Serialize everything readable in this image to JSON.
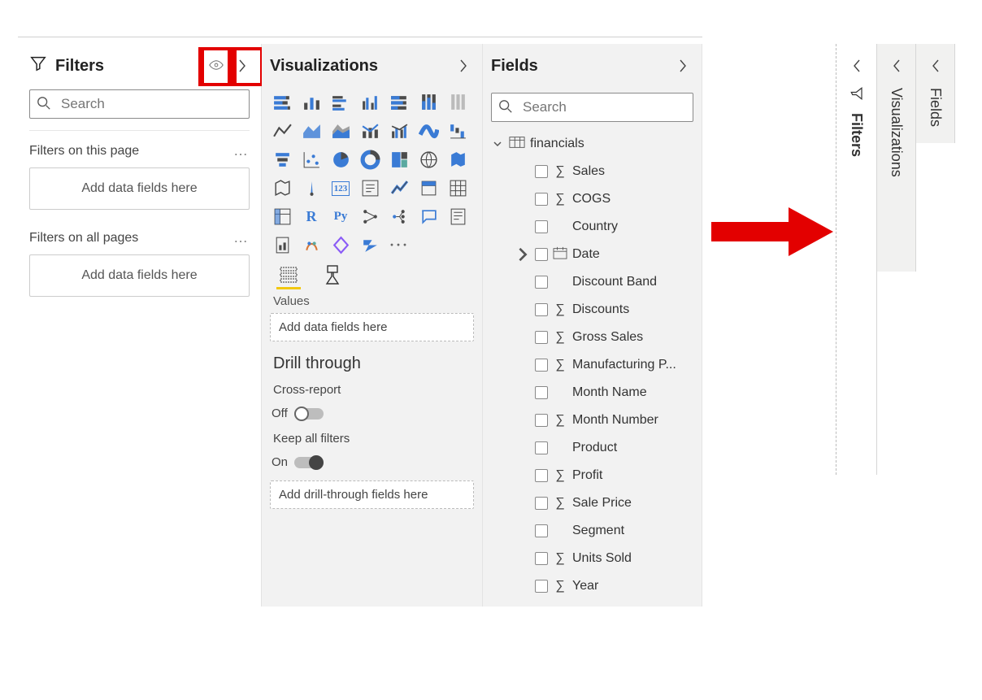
{
  "filters": {
    "title": "Filters",
    "search_placeholder": "Search",
    "section_this_page": "Filters on this page",
    "section_all_pages": "Filters on all pages",
    "drop_label": "Add data fields here"
  },
  "viz": {
    "title": "Visualizations",
    "values_label": "Values",
    "values_drop": "Add data fields here",
    "drill": {
      "title": "Drill through",
      "cross_report_label": "Cross-report",
      "cross_report_value": "Off",
      "keep_filters_label": "Keep all filters",
      "keep_filters_value": "On",
      "drop_label": "Add drill-through fields here"
    },
    "icons": [
      "stacked-bar",
      "stacked-column",
      "clustered-bar",
      "clustered-column",
      "hundred-bar",
      "hundred-column",
      "eraser",
      "line",
      "area",
      "stacked-area",
      "line-stacked",
      "line-clustered",
      "ribbon",
      "waterfall",
      "funnel-sm",
      "scatter",
      "pie",
      "donut",
      "treemap",
      "map",
      "filled-map",
      "azure-map",
      "gauge",
      "card",
      "multi-card",
      "kpi",
      "slicer",
      "table",
      "matrix",
      "r-visual",
      "python",
      "key-influencers",
      "decomp",
      "qna",
      "narrative",
      "paginated",
      "arcgis",
      "powerapps",
      "powerautomate",
      "more",
      "",
      ""
    ]
  },
  "fields": {
    "title": "Fields",
    "search_placeholder": "Search",
    "table": "financials",
    "items": [
      {
        "name": "Sales",
        "sigma": true
      },
      {
        "name": "COGS",
        "sigma": true
      },
      {
        "name": "Country",
        "sigma": false
      },
      {
        "name": "Date",
        "date": true,
        "expandable": true
      },
      {
        "name": "Discount Band",
        "sigma": false
      },
      {
        "name": "Discounts",
        "sigma": true
      },
      {
        "name": "Gross Sales",
        "sigma": true
      },
      {
        "name": "Manufacturing P...",
        "sigma": true
      },
      {
        "name": "Month Name",
        "sigma": false
      },
      {
        "name": "Month Number",
        "sigma": true
      },
      {
        "name": "Product",
        "sigma": false
      },
      {
        "name": "Profit",
        "sigma": true
      },
      {
        "name": "Sale Price",
        "sigma": true
      },
      {
        "name": "Segment",
        "sigma": false
      },
      {
        "name": "Units Sold",
        "sigma": true
      },
      {
        "name": "Year",
        "sigma": true
      }
    ]
  },
  "collapsed": {
    "filters": "Filters",
    "viz": "Visualizations",
    "fields": "Fields"
  }
}
